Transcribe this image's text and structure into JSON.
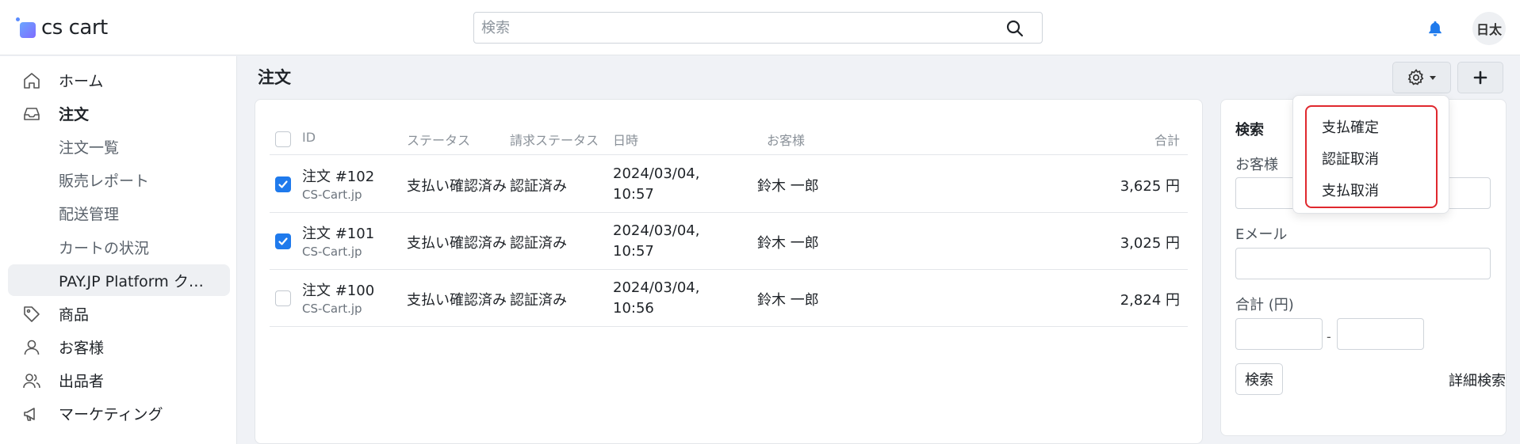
{
  "header": {
    "logo_text": "cs cart",
    "search_placeholder": "検索",
    "language": "日太"
  },
  "sidebar": {
    "items": [
      {
        "label": "ホーム",
        "icon": "home-icon"
      },
      {
        "label": "注文",
        "icon": "inbox-icon"
      },
      {
        "label": "注文一覧"
      },
      {
        "label": "販売レポート"
      },
      {
        "label": "配送管理"
      },
      {
        "label": "カートの状況"
      },
      {
        "label": "PAY.JP Platform クレ..."
      },
      {
        "label": "商品",
        "icon": "tag-icon"
      },
      {
        "label": "お客様",
        "icon": "user-icon"
      },
      {
        "label": "出品者",
        "icon": "users-icon"
      },
      {
        "label": "マーケティング",
        "icon": "megaphone-icon"
      }
    ]
  },
  "main": {
    "title": "注文",
    "columns": {
      "id": "ID",
      "status": "ステータス",
      "billing_status": "請求ステータス",
      "datetime": "日時",
      "customer": "お客様",
      "total": "合計"
    },
    "orders": [
      {
        "checked": true,
        "id": "注文 #102",
        "store": "CS-Cart.jp",
        "status": "支払い確認済み",
        "billing": "認証済み",
        "date": "2024/03/04,",
        "time": "10:57",
        "customer": "鈴木 一郎",
        "total": "3,625 円"
      },
      {
        "checked": true,
        "id": "注文 #101",
        "store": "CS-Cart.jp",
        "status": "支払い確認済み",
        "billing": "認証済み",
        "date": "2024/03/04,",
        "time": "10:57",
        "customer": "鈴木 一郎",
        "total": "3,025 円"
      },
      {
        "checked": false,
        "id": "注文 #100",
        "store": "CS-Cart.jp",
        "status": "支払い確認済み",
        "billing": "認証済み",
        "date": "2024/03/04,",
        "time": "10:56",
        "customer": "鈴木 一郎",
        "total": "2,824 円"
      }
    ]
  },
  "actions_menu": {
    "items": [
      "支払確定",
      "認証取消",
      "支払取消"
    ],
    "highlight_color": "#e0282e"
  },
  "search_panel": {
    "title": "検索",
    "customer_label": "お客様",
    "email_label": "Eメール",
    "total_label": "合計 (円)",
    "range_separator": "-",
    "search_button": "検索",
    "advanced_link": "詳細検索"
  },
  "colors": {
    "accent": "#1f7aec",
    "bell": "#1f7aec"
  }
}
